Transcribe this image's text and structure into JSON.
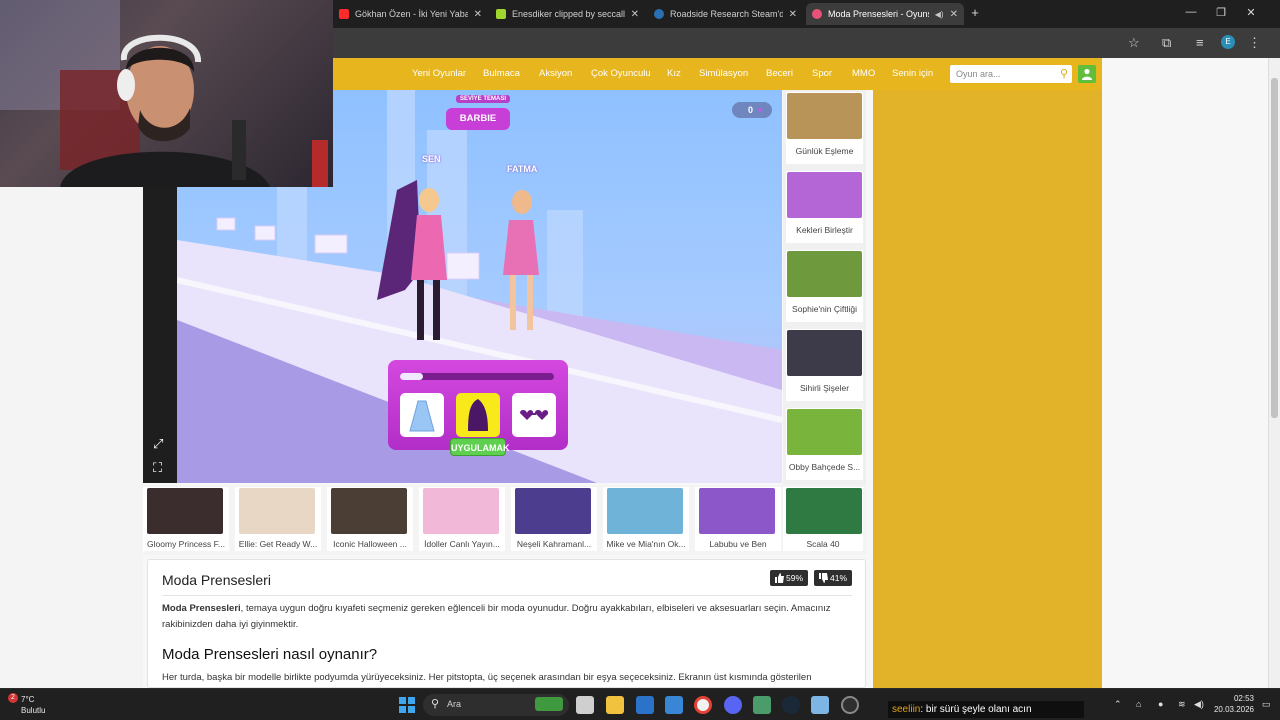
{
  "browser": {
    "tabs": [
      {
        "title": "Gökhan Özen - İki Yeni Yabancı",
        "favicon_color": "#ff2a2a"
      },
      {
        "title": "Enesdiker clipped by seccallss",
        "favicon_color": "#9fd62f"
      },
      {
        "title": "Roadside Research Steam'de %",
        "favicon_color": "#2a6fb3"
      },
      {
        "title": "Moda Prensesleri - Oyunskor",
        "favicon_color": "#e8527a"
      }
    ],
    "new_tab_label": "+"
  },
  "site": {
    "nav": [
      "Yeni Oyunlar",
      "Bulmaca",
      "Aksiyon",
      "Çok Oyunculu",
      "Kız",
      "Simülasyon",
      "Beceri",
      "Spor",
      "MMO",
      "Senin için"
    ],
    "search_placeholder": "Oyun ara...",
    "accent": "#e7b61e"
  },
  "game": {
    "level_label": "SEVİYE TEMASI",
    "theme_name": "BARBIE",
    "player_label": "SEN",
    "rival_label": "FATMA",
    "hearts": "0",
    "progress": 0.15,
    "apply_label": "UYGULAMAK",
    "choices": [
      "dress",
      "cape",
      "glasses"
    ],
    "selected_choice": 1
  },
  "side_games": [
    {
      "name": "Günlük Eşleme",
      "color": "#b89459"
    },
    {
      "name": "Kekleri Birleştir",
      "color": "#b466d6"
    },
    {
      "name": "Sophie'nin Çiftliği",
      "color": "#6e9a3d"
    },
    {
      "name": "Sihirli Şişeler",
      "color": "#3d3a4a"
    },
    {
      "name": "Obby Bahçede S...",
      "color": "#79b43c"
    }
  ],
  "bottom_games": [
    {
      "name": "Gloomy Princess F...",
      "color": "#3b2c2e"
    },
    {
      "name": "Ellie: Get Ready W...",
      "color": "#e8d7c5"
    },
    {
      "name": "Iconic Halloween ...",
      "color": "#4a3e35"
    },
    {
      "name": "İdoller Canlı Yayın...",
      "color": "#f1b8d8"
    },
    {
      "name": "Neşeli Kahramanl...",
      "color": "#4c3d8f"
    },
    {
      "name": "Mike ve Mia'nın Ok...",
      "color": "#6fb3d9"
    },
    {
      "name": "Labubu ve Ben",
      "color": "#8b57c9"
    },
    {
      "name": "Scala 40",
      "color": "#2f7a43"
    }
  ],
  "description": {
    "title": "Moda Prensesleri",
    "likes": "59%",
    "dislikes": "41%",
    "lead": "Moda Prensesleri",
    "body": ", temaya uygun doğru kıyafeti seçmeniz gereken eğlenceli bir moda oyunudur. Doğru ayakkabıları, elbiseleri ve aksesuarları seçin. Amacınız rakibinizden daha iyi giyinmektir.",
    "how_title": "Moda Prensesleri nasıl oynanır?",
    "how_body": "Her turda, başka bir modelle birlikte podyumda yürüyeceksiniz. Her pitstopta, üç seçenek arasından bir eşya seçeceksiniz. Ekranın üst kısmında gösterilen"
  },
  "taskbar": {
    "weather_temp": "7°C",
    "weather_desc": "Bulutlu",
    "weather_badge": "2",
    "search_label": "Ara",
    "chat_user": "seeliin",
    "chat_message": ": bir sürü şeyle olanı acın",
    "time": "02:53",
    "date": "20.03.2026"
  }
}
